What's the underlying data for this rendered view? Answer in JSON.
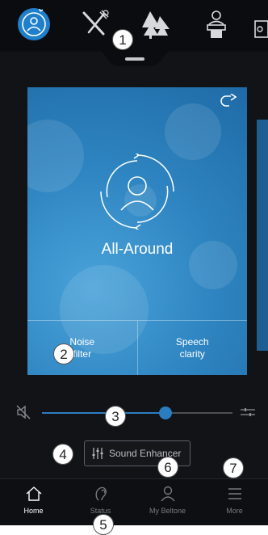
{
  "programs": [
    {
      "name": "all-around-program-icon",
      "active": true
    },
    {
      "name": "restaurant-program-icon",
      "active": false
    },
    {
      "name": "outdoor-program-icon",
      "active": false
    },
    {
      "name": "speaker-program-icon",
      "active": false
    },
    {
      "name": "extra-program-icon",
      "active": false
    }
  ],
  "card": {
    "title": "All-Around",
    "share_icon": "share-icon",
    "emblem_icon": "person-cycle-icon",
    "actions": [
      {
        "line1": "Noise",
        "line2": "filter"
      },
      {
        "line1": "Speech",
        "line2": "clarity"
      }
    ]
  },
  "volume": {
    "level": 0.65,
    "mute_icon": "speaker-muted-icon",
    "eq_icon": "equalizer-icon"
  },
  "sound_enhancer": {
    "label": "Sound Enhancer",
    "icon": "sliders-icon"
  },
  "nav": {
    "items": [
      {
        "label": "Home",
        "icon": "home-icon",
        "active": true
      },
      {
        "label": "Status",
        "icon": "hearing-aid-icon",
        "active": false
      },
      {
        "label": "My Beltone",
        "icon": "user-icon",
        "active": false
      },
      {
        "label": "More",
        "icon": "menu-icon",
        "active": false
      }
    ]
  },
  "callouts": [
    "1",
    "2",
    "3",
    "4",
    "5",
    "6",
    "7"
  ],
  "colors": {
    "accent": "#2c7cc0",
    "background": "#111317",
    "card": "#2f86c2"
  }
}
